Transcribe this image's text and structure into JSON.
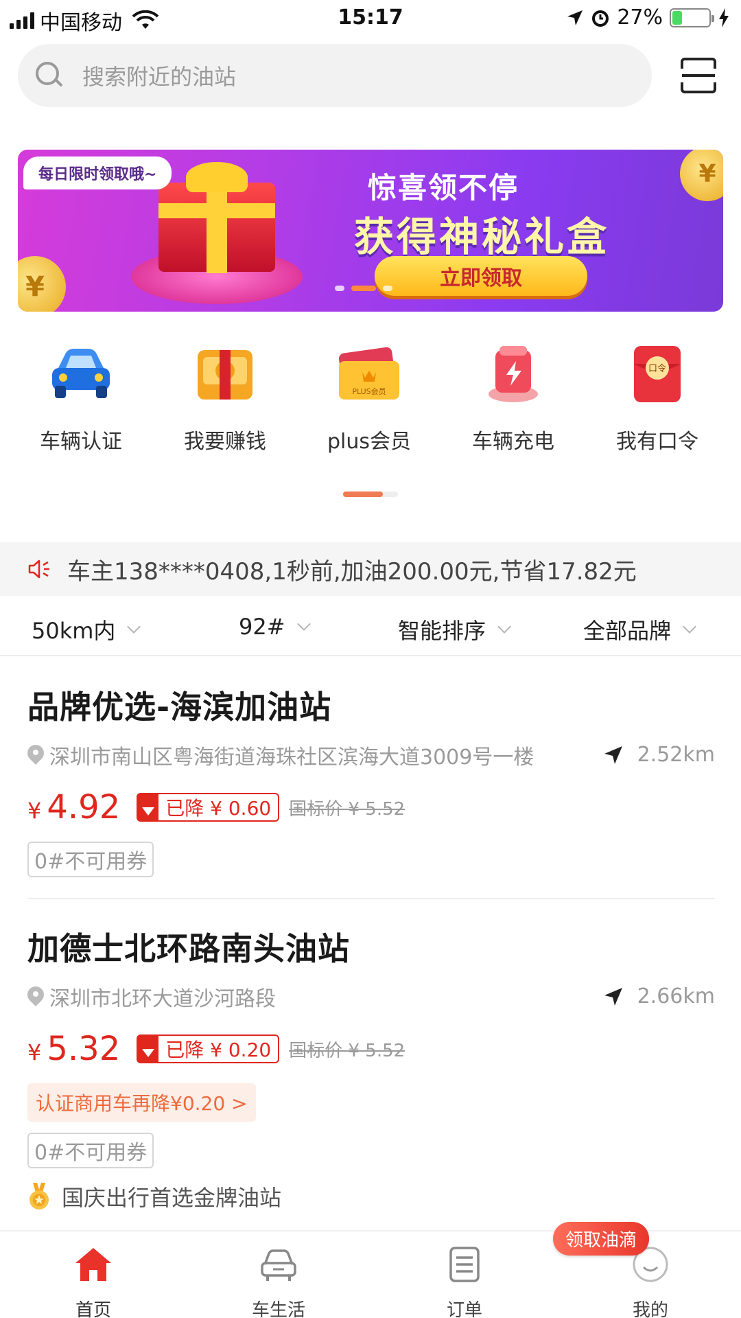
{
  "status_bar": {
    "carrier": "中国移动",
    "time": "15:17",
    "battery": "27%",
    "battery_level": 0.27
  },
  "search": {
    "placeholder": "搜索附近的油站",
    "icon": "search-icon",
    "scan_icon": "scan-icon"
  },
  "banner": {
    "tag": "每日限时领取哦~",
    "subtitle": "惊喜领不停",
    "title": "获得神秘礼盒",
    "button": "立即领取",
    "coin_symbol": "¥"
  },
  "quick_entries": [
    {
      "label": "车辆认证",
      "icon": "car-icon"
    },
    {
      "label": "我要赚钱",
      "icon": "money-icon"
    },
    {
      "label": "plus会员",
      "icon": "plus-card-icon",
      "icon_text": "PLUS会员"
    },
    {
      "label": "车辆充电",
      "icon": "charging-icon"
    },
    {
      "label": "我有口令",
      "icon": "red-envelope-icon",
      "icon_text": "口令"
    }
  ],
  "notice": {
    "text": "车主138****0408,1秒前,加油200.00元,节省17.82元"
  },
  "filters": [
    {
      "label": "50km内"
    },
    {
      "label": "92#"
    },
    {
      "label": "智能排序"
    },
    {
      "label": "全部品牌"
    }
  ],
  "stations": [
    {
      "name": "品牌优选-海滨加油站",
      "address": "深圳市南山区粤海街道海珠社区滨海大道3009号一楼",
      "distance": "2.52km",
      "currency": "¥",
      "price": "4.92",
      "drop": "已降 ¥ 0.60",
      "list_price": "国标价 ¥ 5.52",
      "coupon": "0#不可用券"
    },
    {
      "name": "加德士北环路南头油站",
      "address": "深圳市北环大道沙河路段",
      "distance": "2.66km",
      "currency": "¥",
      "price": "5.32",
      "drop": "已降 ¥ 0.20",
      "list_price": "国标价 ¥ 5.52",
      "promo": "认证商用车再降¥0.20 >",
      "coupon": "0#不可用券",
      "honor": "国庆出行首选金牌油站"
    }
  ],
  "tab_bar": {
    "badge": "领取油滴",
    "items": [
      {
        "label": "首页",
        "icon": "home-icon",
        "active": true
      },
      {
        "label": "车生活",
        "icon": "car-life-icon"
      },
      {
        "label": "订单",
        "icon": "order-icon"
      },
      {
        "label": "我的",
        "icon": "profile-icon"
      }
    ]
  },
  "colors": {
    "accent": "#e0271e",
    "promo": "#ef6a3b",
    "indicator": "#f07a52",
    "home_active": "#e8322a"
  }
}
